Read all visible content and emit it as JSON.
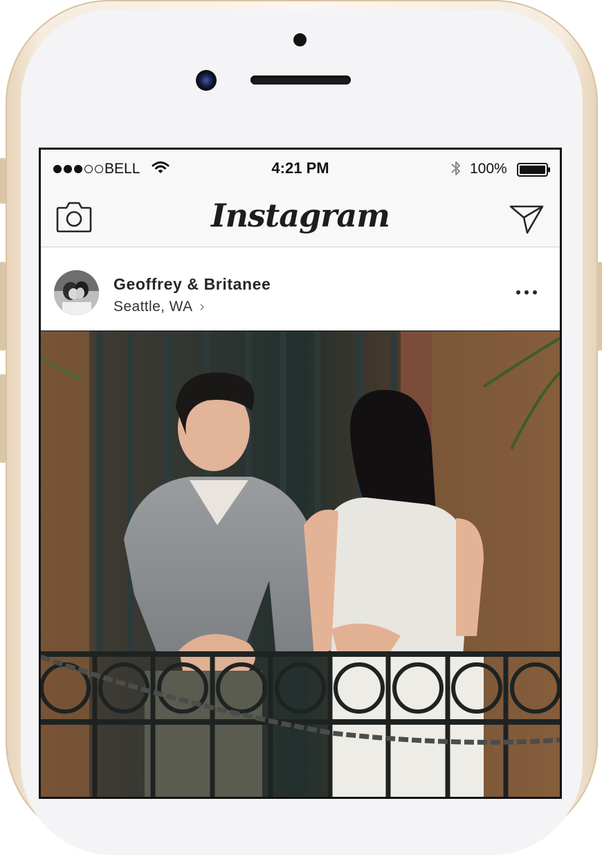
{
  "status_bar": {
    "carrier": "BELL",
    "time": "4:21 PM",
    "battery_percent": "100%",
    "signal_strength": 3,
    "signal_dots": 5
  },
  "app_header": {
    "logo_text": "Instagram",
    "left_icon": "camera-icon",
    "right_icon": "direct-message-icon"
  },
  "post": {
    "username": "Geoffrey & Britanee",
    "location": "Seattle, WA",
    "more_icon": "more-options-icon"
  },
  "colors": {
    "phone_gold": "#e7d3b8",
    "text_dark": "#262626"
  }
}
